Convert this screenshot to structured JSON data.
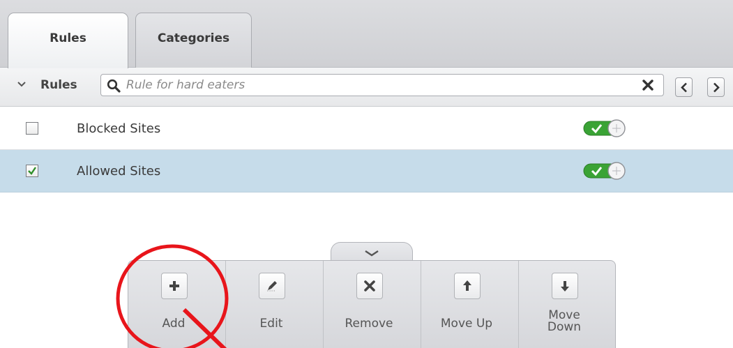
{
  "tabs": [
    {
      "label": "Rules",
      "active": true
    },
    {
      "label": "Categories",
      "active": false
    }
  ],
  "search_row": {
    "section_label": "Rules",
    "search_placeholder": "Rule for hard eaters",
    "search_value": ""
  },
  "rules": [
    {
      "name": "Blocked Sites",
      "checked": false,
      "enabled": true,
      "selected": false
    },
    {
      "name": "Allowed Sites",
      "checked": true,
      "enabled": true,
      "selected": true
    }
  ],
  "toolbar": {
    "buttons": [
      {
        "label": "Add",
        "icon": "plus-icon"
      },
      {
        "label": "Edit",
        "icon": "pencil-icon"
      },
      {
        "label": "Remove",
        "icon": "x-icon"
      },
      {
        "label": "Move Up",
        "icon": "arrow-up-icon"
      },
      {
        "label": "Move\nDown",
        "icon": "arrow-down-icon"
      }
    ]
  },
  "colors": {
    "selected_row": "#c6dcea",
    "toggle_on": "#3aa335",
    "annotation": "#e8151b",
    "checkmark": "#2f8f2a"
  }
}
